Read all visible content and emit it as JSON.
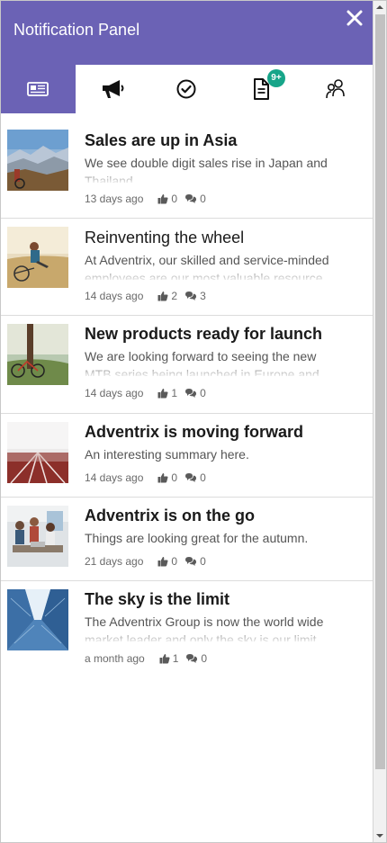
{
  "header": {
    "title": "Notification Panel"
  },
  "tabs": [
    {
      "icon": "newspaper-icon",
      "active": true
    },
    {
      "icon": "megaphone-icon",
      "active": false
    },
    {
      "icon": "check-circle-icon",
      "active": false
    },
    {
      "icon": "document-icon",
      "active": false,
      "badge": "9+"
    },
    {
      "icon": "users-icon",
      "active": false
    }
  ],
  "colors": {
    "accent": "#6b62b5",
    "badge": "#17a589",
    "text": "#1a1a1a",
    "muted": "#6a6a6a"
  },
  "items": [
    {
      "title": "Sales are up in Asia",
      "summary": "We see double digit sales rise in Japan and Thailand",
      "time": "13 days ago",
      "likes": "0",
      "comments": "0",
      "image": "mountain-landscape-photo"
    },
    {
      "title": "Reinventing the wheel",
      "summary": "At Adventrix, our skilled and service-minded employees are our most valuable resource",
      "time": "14 days ago",
      "likes": "2",
      "comments": "3",
      "image": "cyclist-resting-photo"
    },
    {
      "title": "New products ready for launch",
      "summary": "We are looking forward to seeing the new MTB series being launched in Europe and North",
      "time": "14 days ago",
      "likes": "1",
      "comments": "0",
      "image": "bike-by-tree-photo"
    },
    {
      "title": "Adventrix is moving forward",
      "summary": "An interesting summary here.",
      "time": "14 days ago",
      "likes": "0",
      "comments": "0",
      "image": "running-track-photo"
    },
    {
      "title": "Adventrix is on the go",
      "summary": "Things are looking great for the autumn.",
      "time": "21 days ago",
      "likes": "0",
      "comments": "0",
      "image": "office-team-photo"
    },
    {
      "title": "The sky is the limit",
      "summary": "The Adventrix Group is now the world wide market leader and only the sky is our limit",
      "time": "a month ago",
      "likes": "1",
      "comments": "0",
      "image": "skyscrapers-photo"
    }
  ]
}
